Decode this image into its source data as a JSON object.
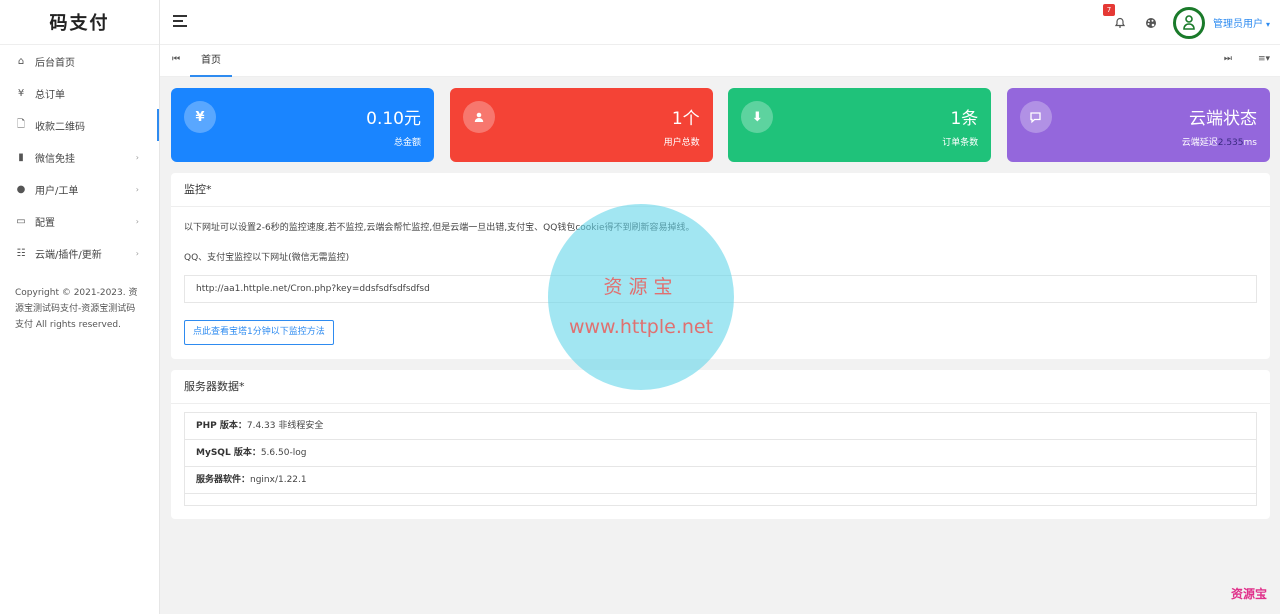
{
  "brand": "码支付",
  "sidebar": {
    "items": [
      {
        "label": "后台首页",
        "icon": "home-icon",
        "glyph": "⌂",
        "has_arrow": false
      },
      {
        "label": "总订单",
        "icon": "yen-icon",
        "glyph": "¥",
        "has_arrow": false
      },
      {
        "label": "收款二维码",
        "icon": "document-icon",
        "glyph": "🗋",
        "has_arrow": false
      },
      {
        "label": "微信免挂",
        "icon": "book-icon",
        "glyph": "▮",
        "has_arrow": true
      },
      {
        "label": "用户/工单",
        "icon": "user-icon",
        "glyph": "●",
        "has_arrow": true
      },
      {
        "label": "配置",
        "icon": "folder-icon",
        "glyph": "▭",
        "has_arrow": true
      },
      {
        "label": "云端/插件/更新",
        "icon": "sliders-icon",
        "glyph": "☷",
        "has_arrow": true
      }
    ],
    "copyright": "Copyright © 2021-2023. 资源宝测试码支付-资源宝测试码支付 All rights reserved."
  },
  "topbar": {
    "notification_count": "7",
    "user_label": "管理员用户"
  },
  "tabs": {
    "home_label": "首页"
  },
  "stats": [
    {
      "value": "0.10元",
      "label": "总金额",
      "icon": "yen-icon",
      "glyph": "¥",
      "color": "#1a85ff"
    },
    {
      "value": "1个",
      "label": "用户总数",
      "icon": "user-icon",
      "glyph": "●",
      "color": "#f44336"
    },
    {
      "value": "1条",
      "label": "订单条数",
      "icon": "download-icon",
      "glyph": "⬇",
      "color": "#1fc27a"
    },
    {
      "value": "云端状态",
      "label": "云端延迟",
      "extra_value": "2.535",
      "extra_unit": "ms",
      "icon": "message-icon",
      "glyph": "▢",
      "color": "#9467dc"
    }
  ],
  "monitor": {
    "title": "监控*",
    "desc": "以下网址可以设置2-6秒的监控速度,若不监控,云端会帮忙监控,但是云端一旦出错,支付宝、QQ钱包cookie得不到刷新容易掉线。",
    "sub": "QQ、支付宝监控以下网址(微信无需监控)",
    "url": "http://aa1.httple.net/Cron.php?key=ddsfsdfsdfsdfsd",
    "button": "点此查看宝塔1分钟以下监控方法"
  },
  "server": {
    "title": "服务器数据*",
    "rows": [
      {
        "key": "PHP 版本：",
        "value": "7.4.33 非线程安全"
      },
      {
        "key": "MySQL 版本：",
        "value": "5.6.50-log"
      },
      {
        "key": "服务器软件：",
        "value": "nginx/1.22.1"
      }
    ]
  },
  "watermark": {
    "line1": "资源宝",
    "line2": "www.httple.net",
    "corner": "资源宝"
  }
}
